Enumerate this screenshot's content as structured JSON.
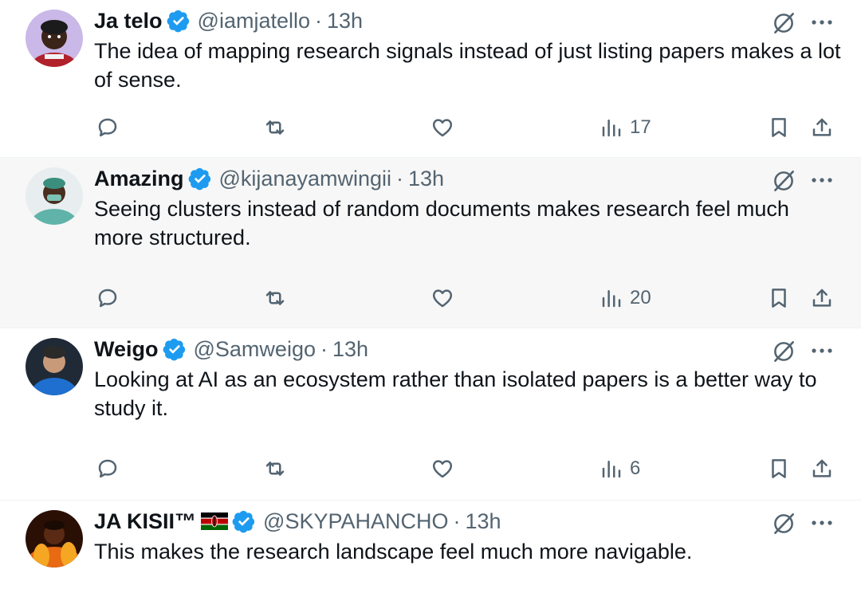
{
  "tweets": [
    {
      "name": "Ja telo",
      "handle": "@iamjatello",
      "separator": "·",
      "time": "13h",
      "text": "The idea of mapping research signals instead of just listing papers makes a lot of sense.",
      "views": "17"
    },
    {
      "name": "Amazing",
      "handle": "@kijanayamwingii",
      "separator": "·",
      "time": "13h",
      "text": "Seeing clusters instead of random documents makes research feel much more structured.",
      "views": "20"
    },
    {
      "name": "Weigo",
      "handle": "@Samweigo",
      "separator": "·",
      "time": "13h",
      "text": "Looking at AI as an ecosystem rather than isolated papers is a better way to study it.",
      "views": "6"
    },
    {
      "name": "JA KISII™",
      "handle": "@SKYPAHANCHO",
      "separator": "·",
      "time": "13h",
      "text": "This makes the research landscape feel much more navigable.",
      "flag": "kenya-flag-icon"
    }
  ],
  "icons": {
    "verified": "verified-badge-icon",
    "grok": "grok-icon",
    "more": "more-options-icon",
    "reply": "reply-icon",
    "retweet": "retweet-icon",
    "like": "heart-icon",
    "views": "views-chart-icon",
    "bookmark": "bookmark-icon",
    "share": "share-icon"
  },
  "colors": {
    "verified": "#1d9bf0",
    "text": "#0f1419",
    "muted": "#536471",
    "highlight_bg": "#f7f7f7"
  }
}
